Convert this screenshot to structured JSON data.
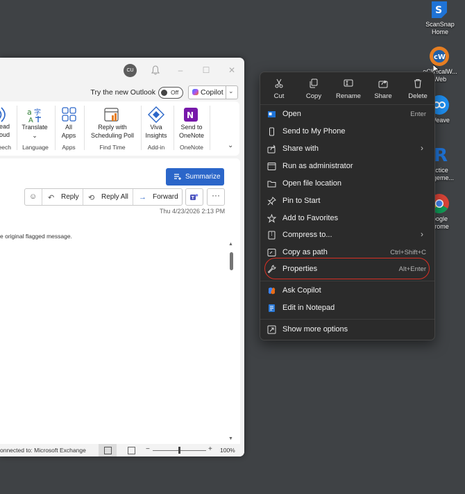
{
  "outlook": {
    "avatar_initials": "CU",
    "try_new_outlook": "Try the new Outlook",
    "toggle_state": "Off",
    "copilot_label": "Copilot",
    "ribbon": {
      "speech_partial": {
        "line1": "ead",
        "line2": "oud",
        "group": "eech"
      },
      "translate": {
        "label": "Translate",
        "caret": "⌄",
        "group": "Language"
      },
      "all_apps": {
        "line1": "All",
        "line2": "Apps",
        "group": "Apps"
      },
      "scheduling": {
        "line1": "Reply with",
        "line2": "Scheduling Poll",
        "group": "Find Time"
      },
      "viva": {
        "line1": "Viva",
        "line2": "Insights",
        "group": "Add-in"
      },
      "onenote": {
        "line1": "Send to",
        "line2": "OneNote",
        "group": "OneNote"
      }
    },
    "summarize_label": "Summarize",
    "actions": {
      "reply": "Reply",
      "reply_all": "Reply All",
      "forward": "Forward"
    },
    "timestamp": "Thu 4/23/2026 2:13 PM",
    "body_text": "e original flagged message.",
    "status_text": "onnected to: Microsoft Exchange",
    "zoom_level": "100%"
  },
  "desktop_icons": [
    {
      "line1": "ScanSnap",
      "line2": "Home",
      "icon": "scansnap-icon"
    },
    {
      "line1": "eClinicalW...",
      "line2": "Web",
      "icon": "eclinicalworks-icon"
    },
    {
      "line1": "Weave",
      "line2": "",
      "icon": "weave-icon"
    },
    {
      "line1": "actice",
      "line2": "nageme...",
      "icon": "practice-management-icon"
    },
    {
      "line1": "oogle",
      "line2": "hrome",
      "icon": "chrome-icon"
    }
  ],
  "context_menu": {
    "top_actions": [
      "Cut",
      "Copy",
      "Rename",
      "Share",
      "Delete"
    ],
    "items": [
      {
        "label": "Open",
        "shortcut": "Enter"
      },
      {
        "label": "Send to My Phone",
        "shortcut": ""
      },
      {
        "label": "Share with",
        "shortcut": "›"
      },
      {
        "label": "Run as administrator",
        "shortcut": ""
      },
      {
        "label": "Open file location",
        "shortcut": ""
      },
      {
        "label": "Pin to Start",
        "shortcut": ""
      },
      {
        "label": "Add to Favorites",
        "shortcut": ""
      },
      {
        "label": "Compress to...",
        "shortcut": "›"
      },
      {
        "label": "Copy as path",
        "shortcut": "Ctrl+Shift+C"
      },
      {
        "label": "Properties",
        "shortcut": "Alt+Enter"
      },
      {
        "label": "Ask Copilot",
        "shortcut": ""
      },
      {
        "label": "Edit in Notepad",
        "shortcut": ""
      },
      {
        "label": "Show more options",
        "shortcut": ""
      }
    ]
  },
  "colors": {
    "accent_blue": "#2b66c9",
    "highlight_ring": "#d93025",
    "menu_bg": "#2b2b2b",
    "desktop_bg": "#3f4245"
  }
}
